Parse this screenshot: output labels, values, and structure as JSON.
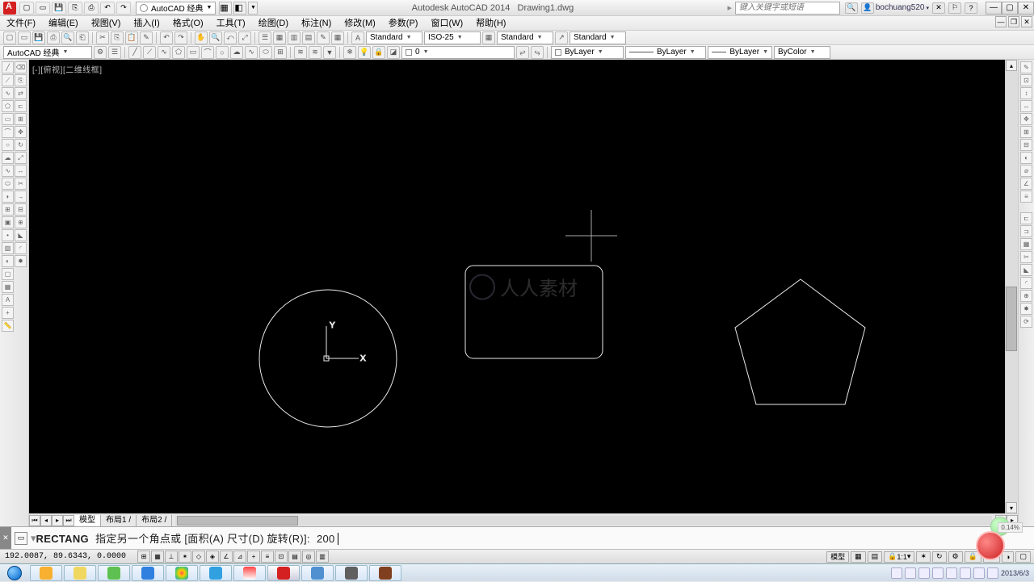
{
  "title": {
    "app": "Autodesk AutoCAD 2014",
    "file": "Drawing1.dwg"
  },
  "workspace": "AutoCAD 经典",
  "search_placeholder": "键入关键字或短语",
  "user": "bochuang520",
  "menus": [
    "文件(F)",
    "编辑(E)",
    "视图(V)",
    "插入(I)",
    "格式(O)",
    "工具(T)",
    "绘图(D)",
    "标注(N)",
    "修改(M)",
    "参数(P)",
    "窗口(W)",
    "帮助(H)"
  ],
  "toolbar2": {
    "textstyle": "Standard",
    "dimstyle": "ISO-25",
    "tablestyle": "Standard",
    "mlstyle": "Standard"
  },
  "toolbar3": {
    "workspace": "AutoCAD 经典",
    "layer": "0",
    "ltype": "ByLayer",
    "lweight": "ByLayer",
    "color_lbl": "ByLayer",
    "plotstyle": "ByColor"
  },
  "viewport_label": "[-][俯视][二维线框]",
  "ucs": {
    "x": "X",
    "y": "Y"
  },
  "tabs": {
    "model": "模型",
    "layout1": "布局1",
    "layout2": "布局2"
  },
  "command": {
    "keyword": "RECTANG",
    "prompt": "指定另一个角点或 [面积(A) 尺寸(D) 旋转(R)]:",
    "input": "200"
  },
  "status": {
    "coords": "192.0087, 89.6343, 0.0000",
    "right": {
      "space": "模型",
      "scale": "1:1",
      "anno": ""
    }
  },
  "tray": {
    "time": "",
    "date": "2013/6/3"
  },
  "watermark": "人人素材",
  "badge": "0.14%"
}
